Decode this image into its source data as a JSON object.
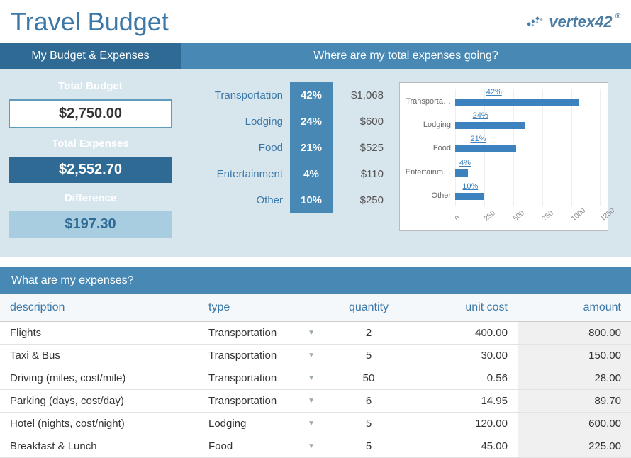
{
  "title": "Travel Budget",
  "brand": "vertex42",
  "left": {
    "header": "My Budget & Expenses",
    "budget_label": "Total Budget",
    "budget_value": "$2,750.00",
    "expenses_label": "Total Expenses",
    "expenses_value": "$2,552.70",
    "diff_label": "Difference",
    "diff_value": "$197.30"
  },
  "right": {
    "header": "Where are my total expenses going?",
    "breakdown": [
      {
        "category": "Transportation",
        "pct": "42%",
        "amount": "$1,068"
      },
      {
        "category": "Lodging",
        "pct": "24%",
        "amount": "$600"
      },
      {
        "category": "Food",
        "pct": "21%",
        "amount": "$525"
      },
      {
        "category": "Entertainment",
        "pct": "4%",
        "amount": "$110"
      },
      {
        "category": "Other",
        "pct": "10%",
        "amount": "$250"
      }
    ]
  },
  "chart_data": {
    "type": "bar",
    "orientation": "horizontal",
    "categories": [
      "Transporta…",
      "Lodging",
      "Food",
      "Entertainm…",
      "Other"
    ],
    "values": [
      1068,
      600,
      525,
      110,
      250
    ],
    "bar_labels": [
      "42%",
      "24%",
      "21%",
      "4%",
      "10%"
    ],
    "x_ticks": [
      0,
      250,
      500,
      750,
      1000,
      1250
    ],
    "xlim": [
      0,
      1250
    ]
  },
  "expenses": {
    "header": "What are my expenses?",
    "columns": {
      "description": "description",
      "type": "type",
      "quantity": "quantity",
      "unit_cost": "unit cost",
      "amount": "amount"
    },
    "rows": [
      {
        "description": "Flights",
        "type": "Transportation",
        "quantity": "2",
        "unit_cost": "400.00",
        "amount": "800.00"
      },
      {
        "description": "Taxi & Bus",
        "type": "Transportation",
        "quantity": "5",
        "unit_cost": "30.00",
        "amount": "150.00"
      },
      {
        "description": "Driving (miles, cost/mile)",
        "type": "Transportation",
        "quantity": "50",
        "unit_cost": "0.56",
        "amount": "28.00"
      },
      {
        "description": "Parking (days, cost/day)",
        "type": "Transportation",
        "quantity": "6",
        "unit_cost": "14.95",
        "amount": "89.70"
      },
      {
        "description": "Hotel (nights, cost/night)",
        "type": "Lodging",
        "quantity": "5",
        "unit_cost": "120.00",
        "amount": "600.00"
      },
      {
        "description": "Breakfast & Lunch",
        "type": "Food",
        "quantity": "5",
        "unit_cost": "45.00",
        "amount": "225.00"
      }
    ]
  }
}
